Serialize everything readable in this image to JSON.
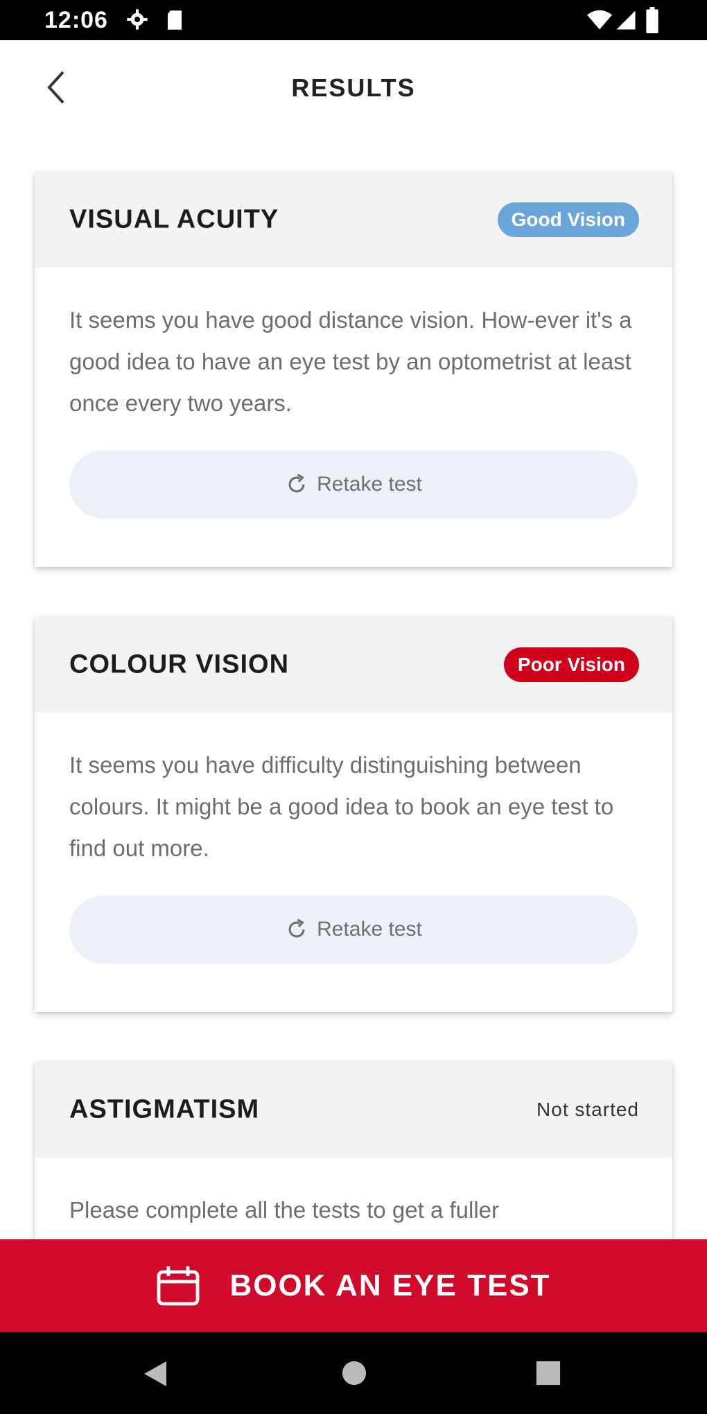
{
  "status_bar": {
    "time": "12:06",
    "icons": [
      "gear-icon",
      "sd-card-icon",
      "wifi-icon",
      "signal-icon",
      "battery-icon"
    ]
  },
  "header": {
    "title": "RESULTS",
    "back_icon": "chevron-left-icon"
  },
  "cards": [
    {
      "title": "VISUAL ACUITY",
      "badge": "Good Vision",
      "badge_color": "#6aa6da",
      "description": "It seems you have good distance vision. How-ever it's a good idea to have an eye test by an optometrist at least once every two years.",
      "retake_label": "Retake test"
    },
    {
      "title": "COLOUR VISION",
      "badge": "Poor Vision",
      "badge_color": "#d0021b",
      "description": "It seems you have difficulty distinguishing between colours. It might be a good idea to book an eye test to find out more.",
      "retake_label": "Retake test"
    },
    {
      "title": "ASTIGMATISM",
      "status": "Not started",
      "description": "Please complete all the tests to get a fuller"
    }
  ],
  "cta": {
    "label": "BOOK AN EYE TEST",
    "icon": "calendar-icon",
    "color": "#d10a2c"
  },
  "nav_bar": {
    "icons": [
      "nav-back-icon",
      "nav-home-icon",
      "nav-recents-icon"
    ]
  }
}
